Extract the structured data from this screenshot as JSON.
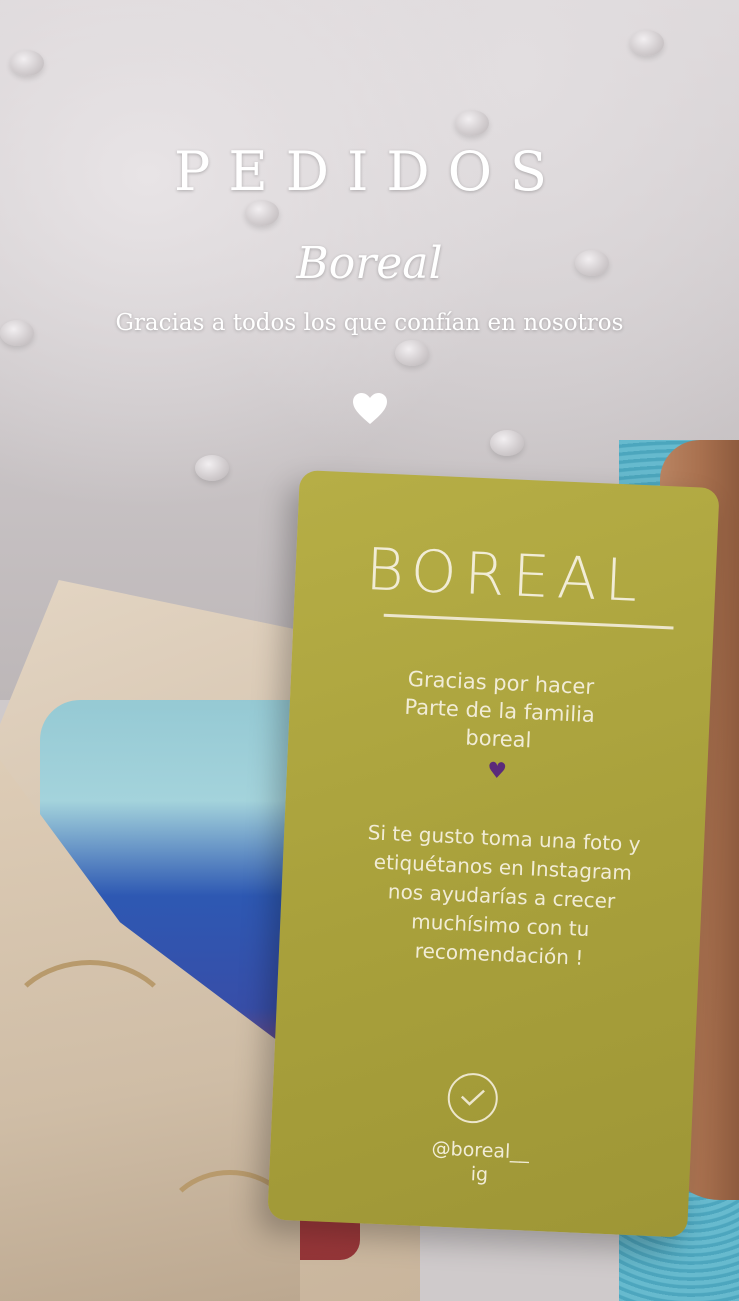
{
  "story": {
    "title": "PEDIDOS",
    "subtitle": "Boreal",
    "caption": "Gracias a todos los que confían en nosotros",
    "heart_icon": "white-heart-icon"
  },
  "card": {
    "brand": "BOREAL",
    "thanks": "Gracias por hacer\nParte de la familia\nboreal",
    "heart_icon": "purple-heart-icon",
    "message": "Si te gusto toma una foto y\netiquétanos en Instagram\nnos ayudarías a crecer\nmuchísimo con tu\nrecomendación !",
    "check_icon": "check-circle-icon",
    "instagram": "@boreal__\nig",
    "color": "#a8a03b"
  }
}
